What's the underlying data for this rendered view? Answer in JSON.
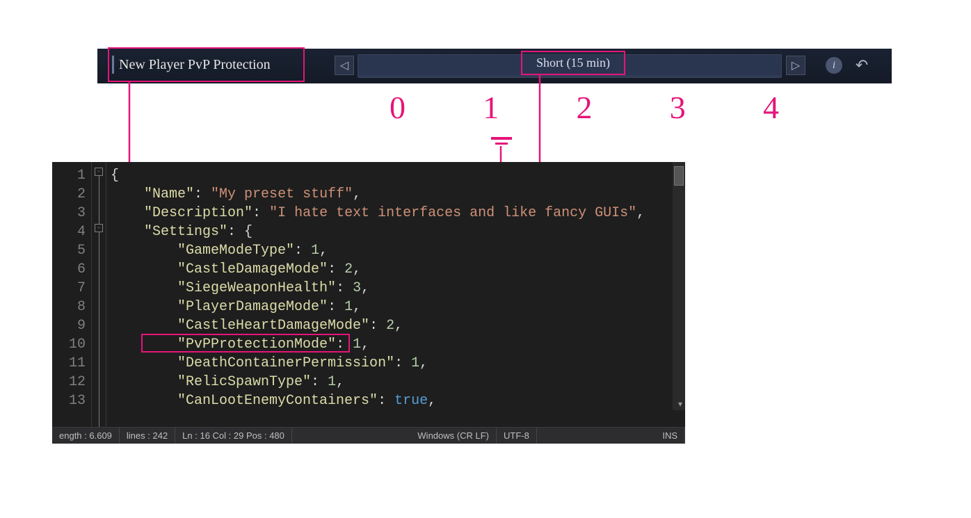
{
  "settings_row": {
    "label": "New Player PvP Protection",
    "selected_value": "Short (15 min)",
    "selected_index": 1,
    "option_indices": [
      "0",
      "1",
      "2",
      "3",
      "4"
    ]
  },
  "icons": {
    "prev": "◁",
    "next": "▷",
    "info": "i",
    "undo": "↶"
  },
  "code": {
    "lines": [
      {
        "n": "1",
        "indent": 0,
        "raw": "{",
        "fold": true
      },
      {
        "n": "2",
        "indent": 1,
        "key": "Name",
        "vstr": "My preset stuff",
        "comma": true
      },
      {
        "n": "3",
        "indent": 1,
        "key": "Description",
        "vstr": "I hate text interfaces and like fancy GUIs",
        "comma": true
      },
      {
        "n": "4",
        "indent": 1,
        "key": "Settings",
        "open": true,
        "fold": true
      },
      {
        "n": "5",
        "indent": 2,
        "key": "GameModeType",
        "vnum": "1",
        "comma": true
      },
      {
        "n": "6",
        "indent": 2,
        "key": "CastleDamageMode",
        "vnum": "2",
        "comma": true
      },
      {
        "n": "7",
        "indent": 2,
        "key": "SiegeWeaponHealth",
        "vnum": "3",
        "comma": true
      },
      {
        "n": "8",
        "indent": 2,
        "key": "PlayerDamageMode",
        "vnum": "1",
        "comma": true
      },
      {
        "n": "9",
        "indent": 2,
        "key": "CastleHeartDamageMode",
        "vnum": "2",
        "comma": true
      },
      {
        "n": "10",
        "indent": 2,
        "key": "PvPProtectionMode",
        "vnum": "1",
        "comma": true,
        "highlight": true
      },
      {
        "n": "11",
        "indent": 2,
        "key": "DeathContainerPermission",
        "vnum": "1",
        "comma": true
      },
      {
        "n": "12",
        "indent": 2,
        "key": "RelicSpawnType",
        "vnum": "1",
        "comma": true
      },
      {
        "n": "13",
        "indent": 2,
        "key": "CanLootEnemyContainers",
        "vkw": "true",
        "comma": true
      }
    ]
  },
  "status": {
    "length": "ength : 6.609",
    "lines": "lines : 242",
    "pos": "Ln : 16   Col : 29   Pos : 480",
    "eol": "Windows (CR LF)",
    "enc": "UTF-8",
    "ins": "INS"
  }
}
